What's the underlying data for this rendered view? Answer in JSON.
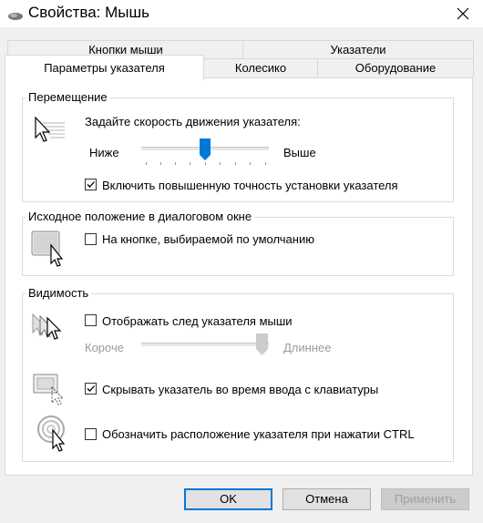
{
  "window": {
    "title": "Свойства: Мышь"
  },
  "tabs": {
    "row1": [
      "Кнопки мыши",
      "Указатели"
    ],
    "row2": [
      "Параметры указателя",
      "Колесико",
      "Оборудование"
    ]
  },
  "motion": {
    "title": "Перемещение",
    "prompt": "Задайте скорость движения указателя:",
    "slow": "Ниже",
    "fast": "Выше",
    "speed_position": 0.5,
    "precision": {
      "label": "Включить повышенную точность установки указателя",
      "checked": true
    }
  },
  "snap": {
    "title": "Исходное положение в диалоговом окне",
    "checkbox": {
      "label": "На кнопке, выбираемой по умолчанию",
      "checked": false
    }
  },
  "visibility": {
    "title": "Видимость",
    "trails": {
      "label": "Отображать след указателя мыши",
      "checked": false
    },
    "short": "Короче",
    "long": "Длиннее",
    "trail_position": 1.0,
    "hide_typing": {
      "label": "Скрывать указатель во время ввода с клавиатуры",
      "checked": true
    },
    "ctrl_locate": {
      "label": "Обозначить расположение указателя при нажатии CTRL",
      "checked": false
    }
  },
  "buttons": {
    "ok": "OK",
    "cancel": "Отмена",
    "apply": "Применить"
  },
  "colors": {
    "accent": "#0078d7",
    "slider_thumb": "#0078d7"
  }
}
